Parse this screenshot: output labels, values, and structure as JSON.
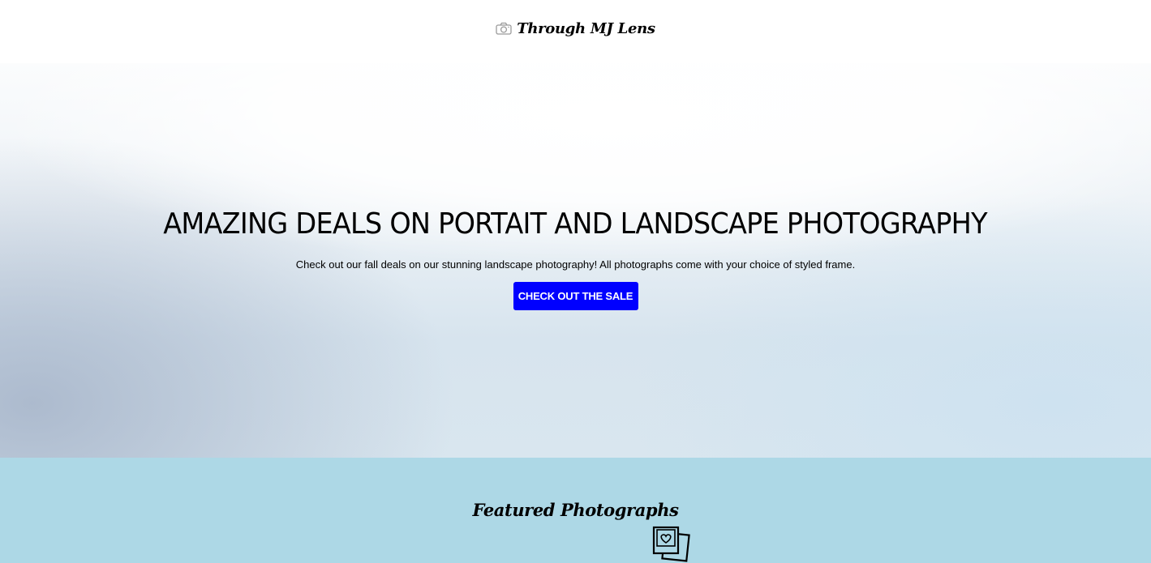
{
  "header": {
    "logo_icon": "camera-icon",
    "brand_name": "Through MJ Lens"
  },
  "hero": {
    "title": "AMAZING DEALS ON PORTAIT AND LANDSCAPE PHOTOGRAPHY",
    "subtitle": "Check out our fall deals on our stunning landscape photography! All photographs come with your choice of styled frame.",
    "cta_label": "CHECK OUT THE SALE",
    "cta_color": "#0000ff"
  },
  "featured": {
    "title": "Featured Photographs",
    "icon": "photos-heart-icon",
    "background_color": "#add8e6"
  }
}
